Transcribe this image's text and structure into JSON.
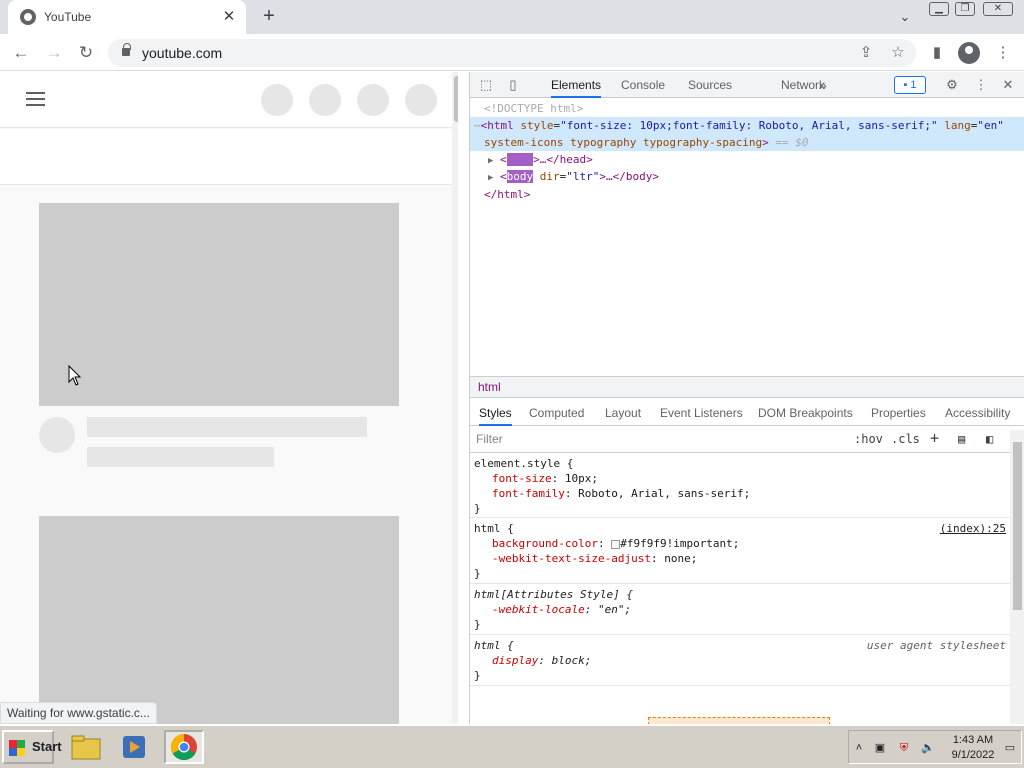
{
  "browser": {
    "tab_title": "YouTube",
    "tab_close": "✕",
    "new_tab": "+",
    "url": "youtube.com",
    "status_text": "Waiting for www.gstatic.c..."
  },
  "devtools": {
    "tabs": [
      "Elements",
      "Console",
      "Sources",
      "Network"
    ],
    "more_tabs": "»",
    "issues_count": "1",
    "dom": {
      "doctype": "<!DOCTYPE html>",
      "html_open_tag": "<html",
      "html_attr_style": "style",
      "html_style_value": "\"font-size: 10px;font-family: Roboto, Arial, sans-serif;\"",
      "html_attr_lang": "lang",
      "html_lang_value": "\"en\"",
      "html_attr_rest": "system-icons typography typography-spacing",
      "html_eq": "== $0",
      "head_tag": "head",
      "head_close": ">…</head>",
      "body_tag": "body",
      "body_attr": "dir",
      "body_dir_value": "\"ltr\"",
      "body_close": ">…</body>",
      "html_close": "</html>"
    },
    "breadcrumb": "html",
    "style_tabs": [
      "Styles",
      "Computed",
      "Layout",
      "Event Listeners",
      "DOM Breakpoints",
      "Properties",
      "Accessibility"
    ],
    "filter_placeholder": "Filter",
    "hov_label": ":hov",
    "cls_label": ".cls",
    "rules": {
      "r1_selector": "element.style {",
      "r1_p1_name": "font-size",
      "r1_p1_value": "10px;",
      "r1_p2_name": "font-family",
      "r1_p2_value": "Roboto, Arial, sans-serif;",
      "r2_selector": "html {",
      "r2_source": "(index):25",
      "r2_p1_name": "background-color",
      "r2_p1_value": "#f9f9f9!important;",
      "r2_p2_name": "-webkit-text-size-adjust",
      "r2_p2_value": "none;",
      "r3_selector": "html[Attributes Style] {",
      "r3_p1_name": "-webkit-locale",
      "r3_p1_value": "\"en\";",
      "r4_selector": "html {",
      "r4_source": "user agent stylesheet",
      "r4_p1_name": "display",
      "r4_p1_value": "block;",
      "close_brace": "}"
    }
  },
  "taskbar": {
    "start_label": "Start",
    "time": "1:43 AM",
    "date": "9/1/2022"
  }
}
